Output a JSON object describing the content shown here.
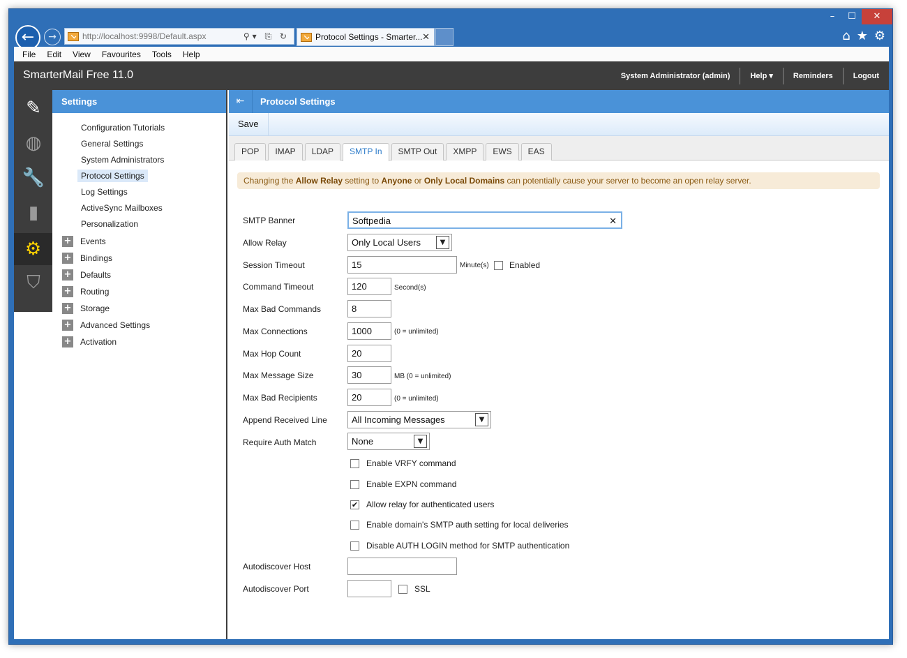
{
  "browser": {
    "address": "http://localhost:9998/Default.aspx",
    "tab_title": "Protocol Settings - Smarter...",
    "window_controls": [
      "–",
      "☐",
      "✕"
    ],
    "menu": [
      "File",
      "Edit",
      "View",
      "Favourites",
      "Tools",
      "Help"
    ]
  },
  "app": {
    "title": "SmarterMail Free 11.0",
    "user": "System Administrator (admin)",
    "help": "Help ▾",
    "reminders": "Reminders",
    "logout": "Logout"
  },
  "sidebar": {
    "header": "Settings",
    "items": [
      "Configuration Tutorials",
      "General Settings",
      "System Administrators",
      "Protocol Settings",
      "Log Settings",
      "ActiveSync Mailboxes",
      "Personalization"
    ],
    "groups": [
      "Events",
      "Bindings",
      "Defaults",
      "Routing",
      "Storage",
      "Advanced Settings",
      "Activation"
    ]
  },
  "main": {
    "title": "Protocol Settings",
    "save": "Save",
    "tabs": [
      "POP",
      "IMAP",
      "LDAP",
      "SMTP In",
      "SMTP Out",
      "XMPP",
      "EWS",
      "EAS"
    ],
    "active_tab": "SMTP In",
    "warning": {
      "p1": "Changing the ",
      "b1": "Allow Relay",
      "p2": " setting to ",
      "b2": "Anyone",
      "p3": " or ",
      "b3": "Only Local Domains",
      "p4": " can potentially cause your server to become an open relay server."
    }
  },
  "form": {
    "smtp_banner": {
      "label": "SMTP Banner",
      "value": "Softpedia"
    },
    "allow_relay": {
      "label": "Allow Relay",
      "value": "Only Local Users"
    },
    "session_timeout": {
      "label": "Session Timeout",
      "value": "15",
      "unit": "Minute(s)",
      "enabled_label": "Enabled",
      "enabled": false
    },
    "command_timeout": {
      "label": "Command Timeout",
      "value": "120",
      "unit": "Second(s)"
    },
    "max_bad_commands": {
      "label": "Max Bad Commands",
      "value": "8"
    },
    "max_connections": {
      "label": "Max Connections",
      "value": "1000",
      "unit": "(0 = unlimited)"
    },
    "max_hop_count": {
      "label": "Max Hop Count",
      "value": "20"
    },
    "max_message_size": {
      "label": "Max Message Size",
      "value": "30",
      "unit": "MB  (0 = unlimited)"
    },
    "max_bad_recipients": {
      "label": "Max Bad Recipients",
      "value": "20",
      "unit": "(0 = unlimited)"
    },
    "append_received_line": {
      "label": "Append Received Line",
      "value": "All Incoming Messages"
    },
    "require_auth_match": {
      "label": "Require Auth Match",
      "value": "None"
    },
    "checkboxes": [
      {
        "label": "Enable VRFY command",
        "checked": false
      },
      {
        "label": "Enable EXPN command",
        "checked": false
      },
      {
        "label": "Allow relay for authenticated users",
        "checked": true
      },
      {
        "label": "Enable domain's SMTP auth setting for local deliveries",
        "checked": false
      },
      {
        "label": "Disable AUTH LOGIN method for SMTP authentication",
        "checked": false
      }
    ],
    "autodiscover_host": {
      "label": "Autodiscover Host",
      "value": ""
    },
    "autodiscover_port": {
      "label": "Autodiscover Port",
      "value": "",
      "ssl_label": "SSL",
      "ssl": false
    }
  }
}
